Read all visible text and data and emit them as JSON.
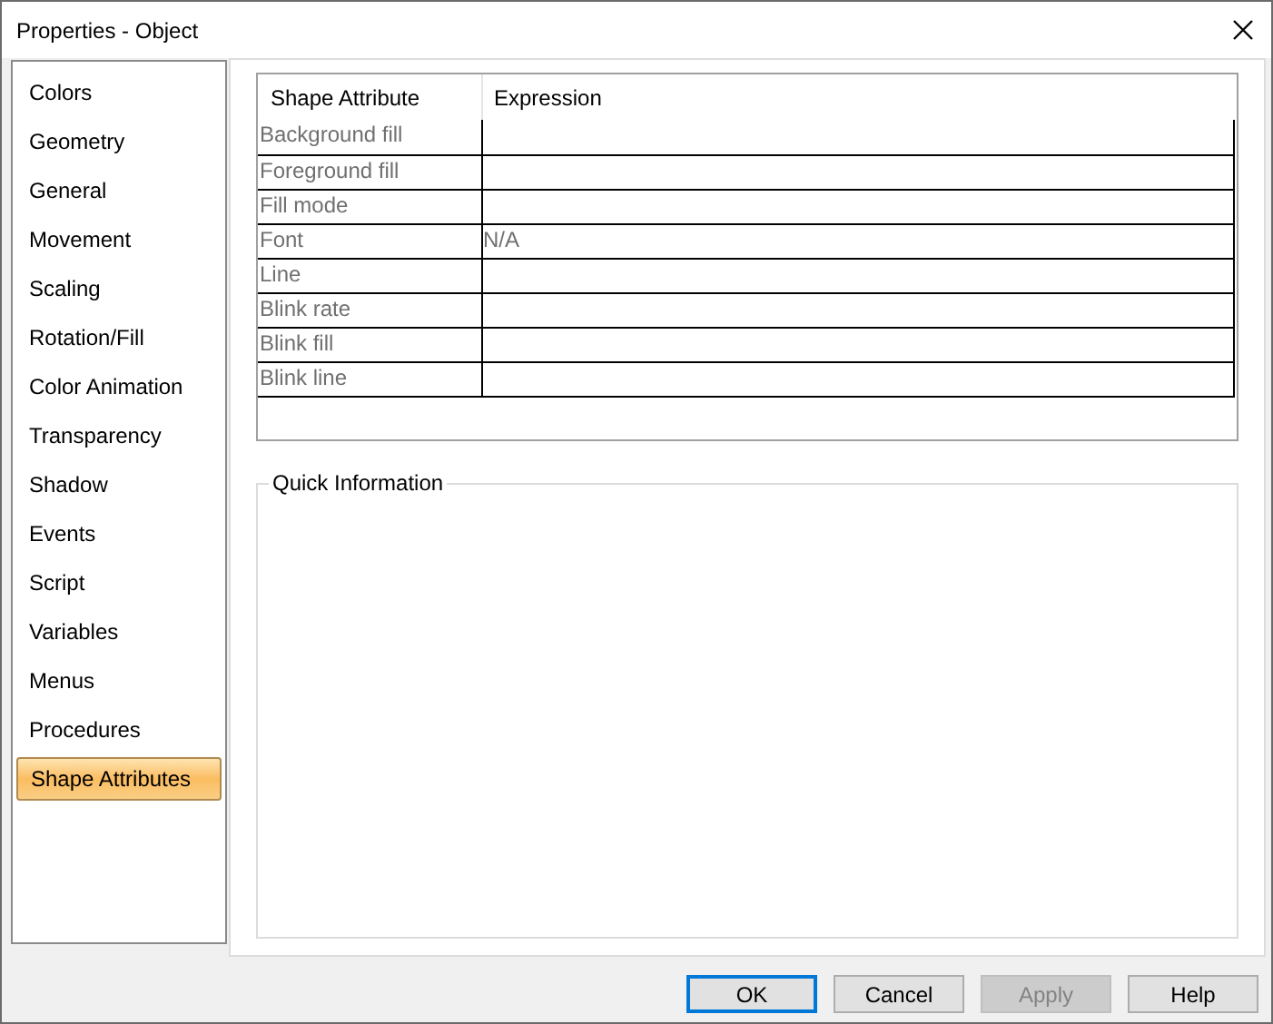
{
  "window": {
    "title": "Properties - Object"
  },
  "sidebar": {
    "items": [
      {
        "label": "Colors",
        "selected": false
      },
      {
        "label": "Geometry",
        "selected": false
      },
      {
        "label": "General",
        "selected": false
      },
      {
        "label": "Movement",
        "selected": false
      },
      {
        "label": "Scaling",
        "selected": false
      },
      {
        "label": "Rotation/Fill",
        "selected": false
      },
      {
        "label": "Color Animation",
        "selected": false
      },
      {
        "label": "Transparency",
        "selected": false
      },
      {
        "label": "Shadow",
        "selected": false
      },
      {
        "label": "Events",
        "selected": false
      },
      {
        "label": "Script",
        "selected": false
      },
      {
        "label": "Variables",
        "selected": false
      },
      {
        "label": "Menus",
        "selected": false
      },
      {
        "label": "Procedures",
        "selected": false
      },
      {
        "label": "Shape Attributes",
        "selected": true
      }
    ]
  },
  "table": {
    "columns": [
      "Shape Attribute",
      "Expression"
    ],
    "rows": [
      {
        "attribute": "Background fill"
      },
      {
        "attribute": "Foreground fill"
      },
      {
        "attribute": "Fill mode"
      },
      {
        "attribute": "Font",
        "expression": "N/A"
      },
      {
        "attribute": "Line"
      },
      {
        "attribute": "Blink rate"
      },
      {
        "attribute": "Blink fill"
      },
      {
        "attribute": "Blink line"
      }
    ]
  },
  "quick_information": {
    "title": "Quick Information"
  },
  "buttons": [
    {
      "label": "OK",
      "default": true,
      "disabled": false
    },
    {
      "label": "Cancel",
      "default": false,
      "disabled": false
    },
    {
      "label": "Apply",
      "default": false,
      "disabled": true
    },
    {
      "label": "Help",
      "default": false,
      "disabled": false
    }
  ]
}
